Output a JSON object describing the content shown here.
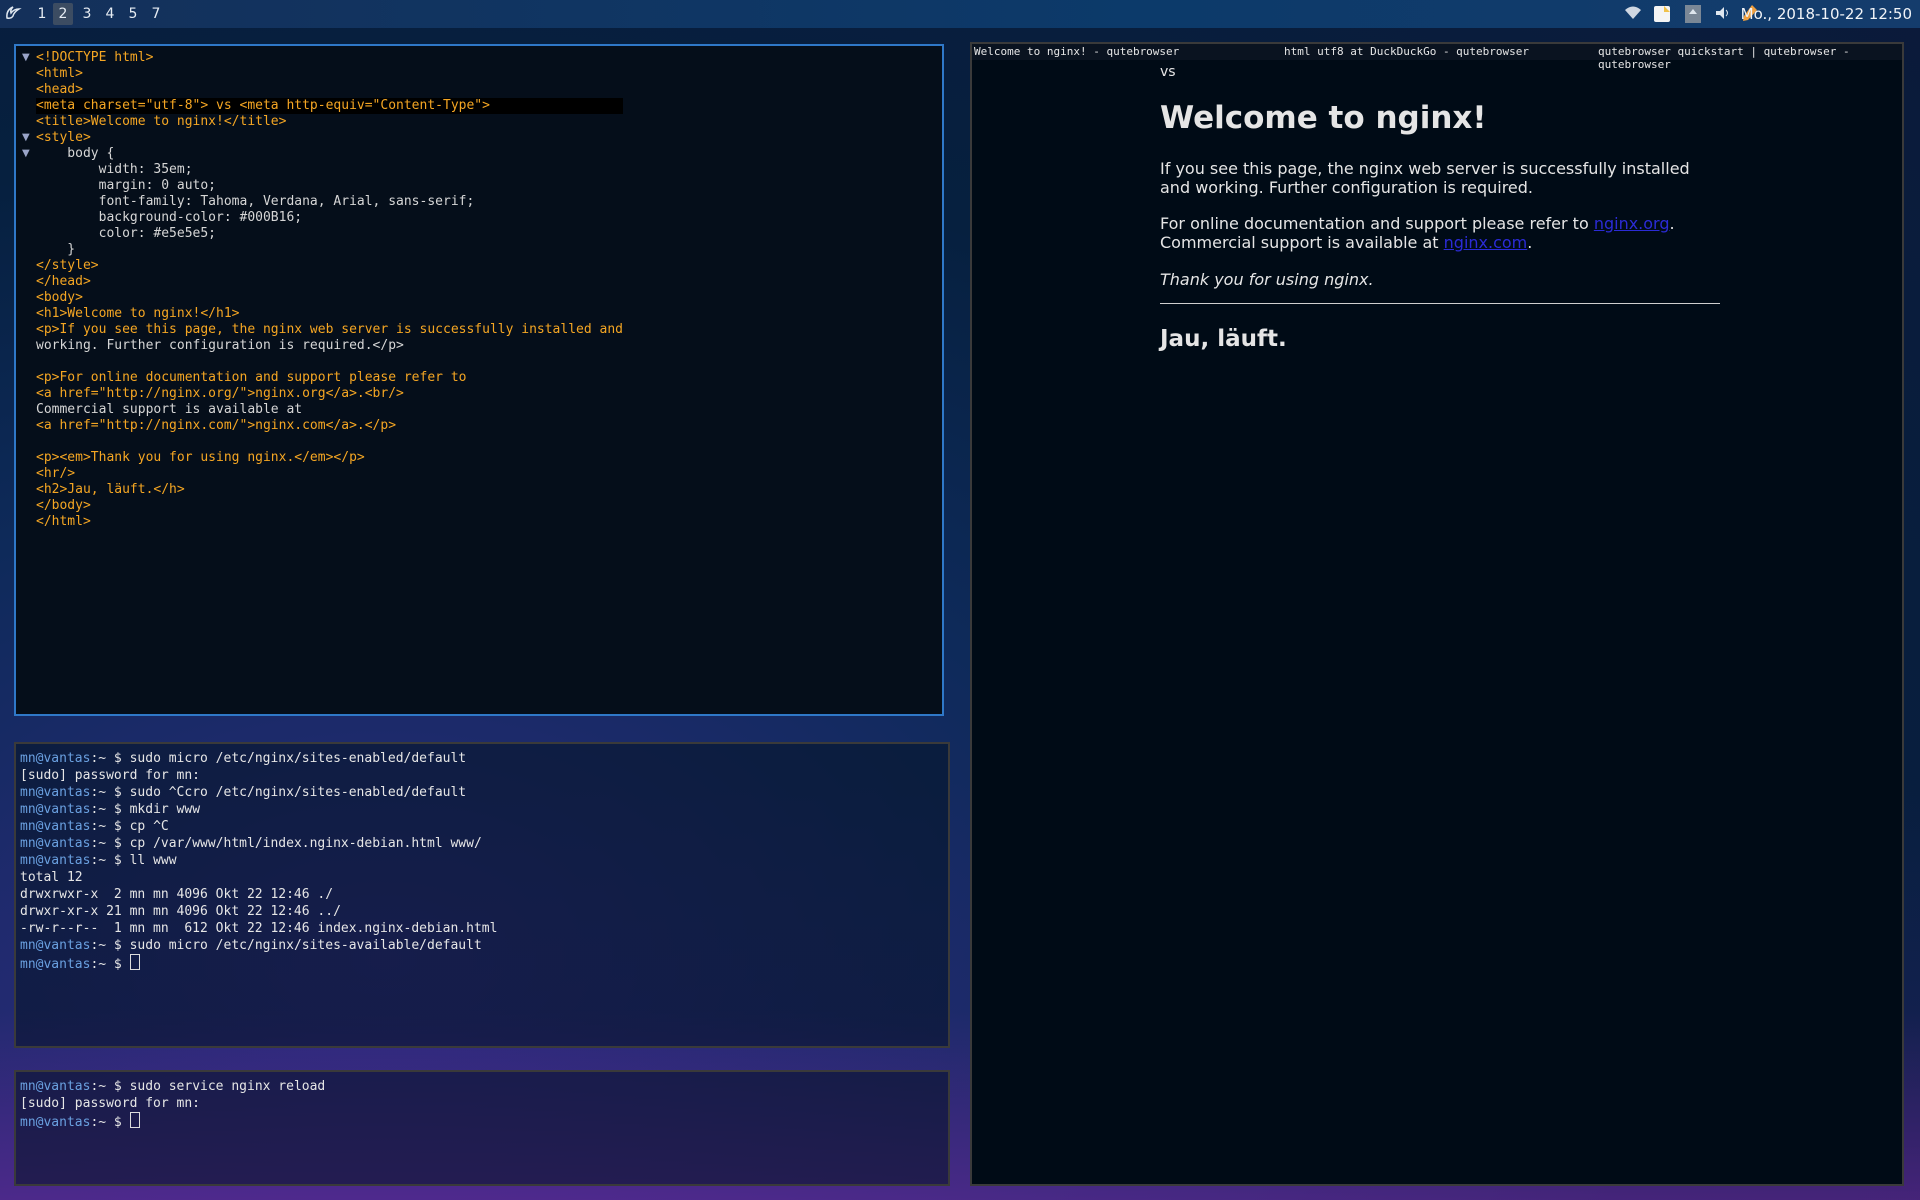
{
  "topbar": {
    "workspaces": [
      "1",
      "2",
      "3",
      "4",
      "5",
      "7"
    ],
    "active_workspace": "2",
    "clock": "Mo., 2018-10-22 12:50"
  },
  "editor": {
    "lines": [
      "<!DOCTYPE html>",
      "<html>",
      "<head>",
      "<meta charset=\"utf-8\"> vs <meta http-equiv=\"Content-Type\">",
      "<title>Welcome to nginx!</title>",
      "<style>",
      "    body {",
      "        width: 35em;",
      "        margin: 0 auto;",
      "        font-family: Tahoma, Verdana, Arial, sans-serif;",
      "        background-color: #000B16;",
      "        color: #e5e5e5;",
      "    }",
      "</style>",
      "</head>",
      "<body>",
      "<h1>Welcome to nginx!</h1>",
      "<p>If you see this page, the nginx web server is successfully installed and",
      "working. Further configuration is required.</p>",
      "",
      "<p>For online documentation and support please refer to",
      "<a href=\"http://nginx.org/\">nginx.org</a>.<br/>",
      "Commercial support is available at",
      "<a href=\"http://nginx.com/\">nginx.com</a>.</p>",
      "",
      "<p><em>Thank you for using nginx.</em></p>",
      "<hr/>",
      "<h2>Jau, läuft.</h>",
      "</body>",
      "</html>"
    ]
  },
  "terminal1": {
    "prompt": "mn@vantas",
    "lines": [
      {
        "p": "mn@vantas",
        "t": ":~ $ sudo micro /etc/nginx/sites-enabled/default"
      },
      {
        "p": "",
        "t": "[sudo] password for mn:"
      },
      {
        "p": "mn@vantas",
        "t": ":~ $ sudo ^Ccro /etc/nginx/sites-enabled/default"
      },
      {
        "p": "mn@vantas",
        "t": ":~ $ mkdir www"
      },
      {
        "p": "mn@vantas",
        "t": ":~ $ cp ^C"
      },
      {
        "p": "mn@vantas",
        "t": ":~ $ cp /var/www/html/index.nginx-debian.html www/"
      },
      {
        "p": "mn@vantas",
        "t": ":~ $ ll www"
      },
      {
        "p": "",
        "t": "total 12"
      },
      {
        "p": "",
        "t": "drwxrwxr-x  2 mn mn 4096 Okt 22 12:46 ./"
      },
      {
        "p": "",
        "t": "drwxr-xr-x 21 mn mn 4096 Okt 22 12:46 ../"
      },
      {
        "p": "",
        "t": "-rw-r--r--  1 mn mn  612 Okt 22 12:46 index.nginx-debian.html"
      },
      {
        "p": "mn@vantas",
        "t": ":~ $ sudo micro /etc/nginx/sites-available/default"
      },
      {
        "p": "mn@vantas",
        "t": ":~ $ "
      }
    ]
  },
  "terminal2": {
    "lines": [
      {
        "p": "mn@vantas",
        "t": ":~ $ sudo service nginx reload"
      },
      {
        "p": "",
        "t": "[sudo] password for mn:"
      },
      {
        "p": "mn@vantas",
        "t": ":~ $ "
      }
    ]
  },
  "browser": {
    "tabs": [
      "Welcome to nginx! - qutebrowser",
      "html utf8 at DuckDuckGo - qutebrowser",
      "qutebrowser quickstart | qutebrowser - qutebrowser"
    ],
    "vs": "vs",
    "h1": "Welcome to nginx!",
    "p1": "If you see this page, the nginx web server is successfully installed and working. Further configuration is required.",
    "p2_prefix": "For online documentation and support please refer to",
    "link1": "nginx.org",
    "p2_mid": "Commercial support is available at",
    "link2": "nginx.com",
    "em": "Thank you for using nginx.",
    "h2": "Jau, läuft."
  }
}
